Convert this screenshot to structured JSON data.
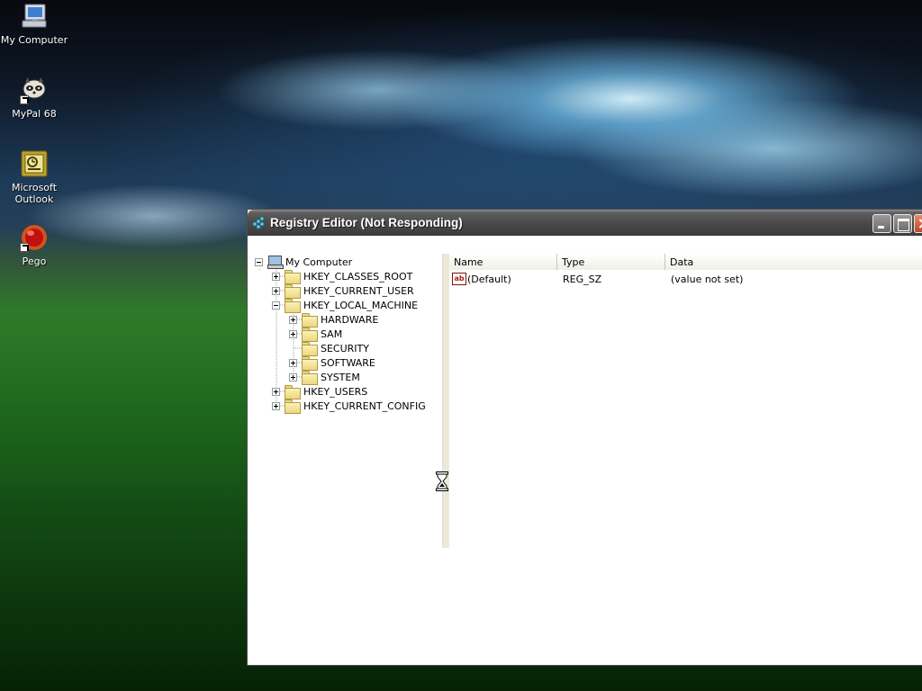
{
  "desktop": {
    "icons": [
      {
        "label": "My Computer",
        "icon": "computer-icon"
      },
      {
        "label": "MyPal 68",
        "icon": "mypal-raccoon-icon"
      },
      {
        "label": "Microsoft\nOutlook",
        "icon": "outlook-icon"
      },
      {
        "label": "Pego",
        "icon": "pego-red-ball-icon"
      }
    ]
  },
  "window": {
    "title": "Registry Editor (Not Responding)",
    "tree": {
      "root": "My Computer",
      "items": [
        {
          "label": "HKEY_CLASSES_ROOT"
        },
        {
          "label": "HKEY_CURRENT_USER"
        },
        {
          "label": "HKEY_LOCAL_MACHINE"
        },
        {
          "label": "HARDWARE"
        },
        {
          "label": "SAM"
        },
        {
          "label": "SECURITY"
        },
        {
          "label": "SOFTWARE"
        },
        {
          "label": "SYSTEM"
        },
        {
          "label": "HKEY_USERS"
        },
        {
          "label": "HKEY_CURRENT_CONFIG"
        }
      ]
    },
    "list": {
      "columns": [
        "Name",
        "Type",
        "Data"
      ],
      "rows": [
        {
          "name": "(Default)",
          "type": "REG_SZ",
          "data": "(value not set)",
          "icon": "ab-string-icon"
        }
      ]
    }
  },
  "colors": {
    "titlebar": "#4a4a4a",
    "folder": "#ecd77e"
  }
}
